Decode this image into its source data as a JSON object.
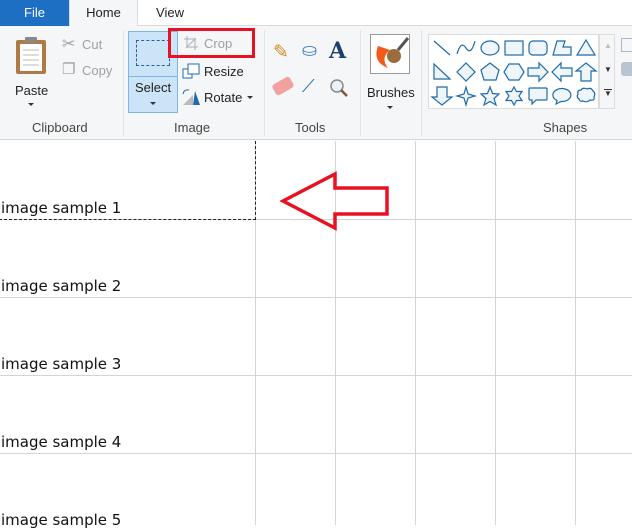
{
  "tabs": [
    {
      "label": "File"
    },
    {
      "label": "Home"
    },
    {
      "label": "View"
    }
  ],
  "clipboard": {
    "paste": "Paste",
    "cut": "Cut",
    "copy": "Copy",
    "group": "Clipboard"
  },
  "image": {
    "select": "Select",
    "crop": "Crop",
    "resize": "Resize",
    "rotate": "Rotate",
    "group": "Image"
  },
  "tools": {
    "group": "Tools",
    "items": [
      "pencil-icon",
      "fill-icon",
      "text-icon",
      "eraser-icon",
      "color-picker-icon",
      "magnifier-icon"
    ]
  },
  "brushes": {
    "label": "Brushes"
  },
  "shapes": {
    "group": "Shapes",
    "items": [
      "line",
      "curve",
      "oval",
      "rectangle",
      "rounded-rectangle",
      "polygon",
      "triangle",
      "right-triangle",
      "diamond",
      "pentagon",
      "hexagon",
      "right-arrow",
      "left-arrow",
      "up-arrow",
      "down-arrow",
      "four-point-star",
      "five-point-star",
      "six-point-star",
      "rounded-rectangular-callout",
      "oval-callout",
      "cloud-callout"
    ]
  },
  "canvas": {
    "rows": [
      {
        "label": "image sample 1"
      },
      {
        "label": "image sample 2"
      },
      {
        "label": "image sample 3"
      },
      {
        "label": "image sample 4"
      },
      {
        "label": "image sample 5"
      }
    ]
  },
  "colors": {
    "accent": "#1c6fc2",
    "highlight": "#e81123",
    "shape_stroke": "#1f6aa8"
  }
}
